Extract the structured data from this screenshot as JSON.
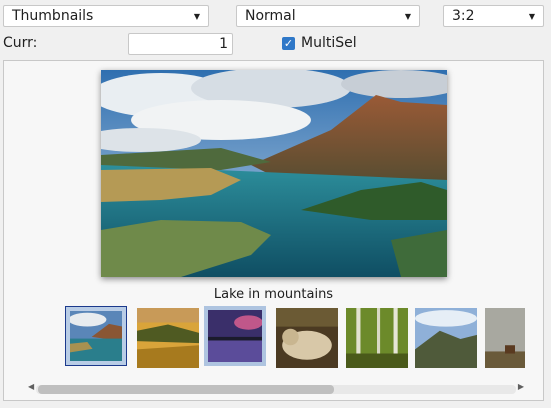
{
  "toolbar": {
    "view_mode": "Thumbnails",
    "thumb_size": "Normal",
    "aspect_ratio": "3:2"
  },
  "current": {
    "label": "Curr:",
    "value": "1"
  },
  "multisel": {
    "label": "MultiSel",
    "checked": true
  },
  "gallery": {
    "caption": "Lake in mountains",
    "thumbnails": [
      {
        "index": 1,
        "subject": "lake in mountains",
        "state": "current"
      },
      {
        "index": 2,
        "subject": "golden hills",
        "state": "normal"
      },
      {
        "index": 3,
        "subject": "purple sunset over lake",
        "state": "selected"
      },
      {
        "index": 4,
        "subject": "dog lying on ground",
        "state": "normal"
      },
      {
        "index": 5,
        "subject": "birch trees",
        "state": "normal"
      },
      {
        "index": 6,
        "subject": "mountain ridge",
        "state": "normal"
      },
      {
        "index": 7,
        "subject": "deer under cloudy sky",
        "state": "normal"
      }
    ]
  },
  "scrollbar": {
    "position": 0
  }
}
